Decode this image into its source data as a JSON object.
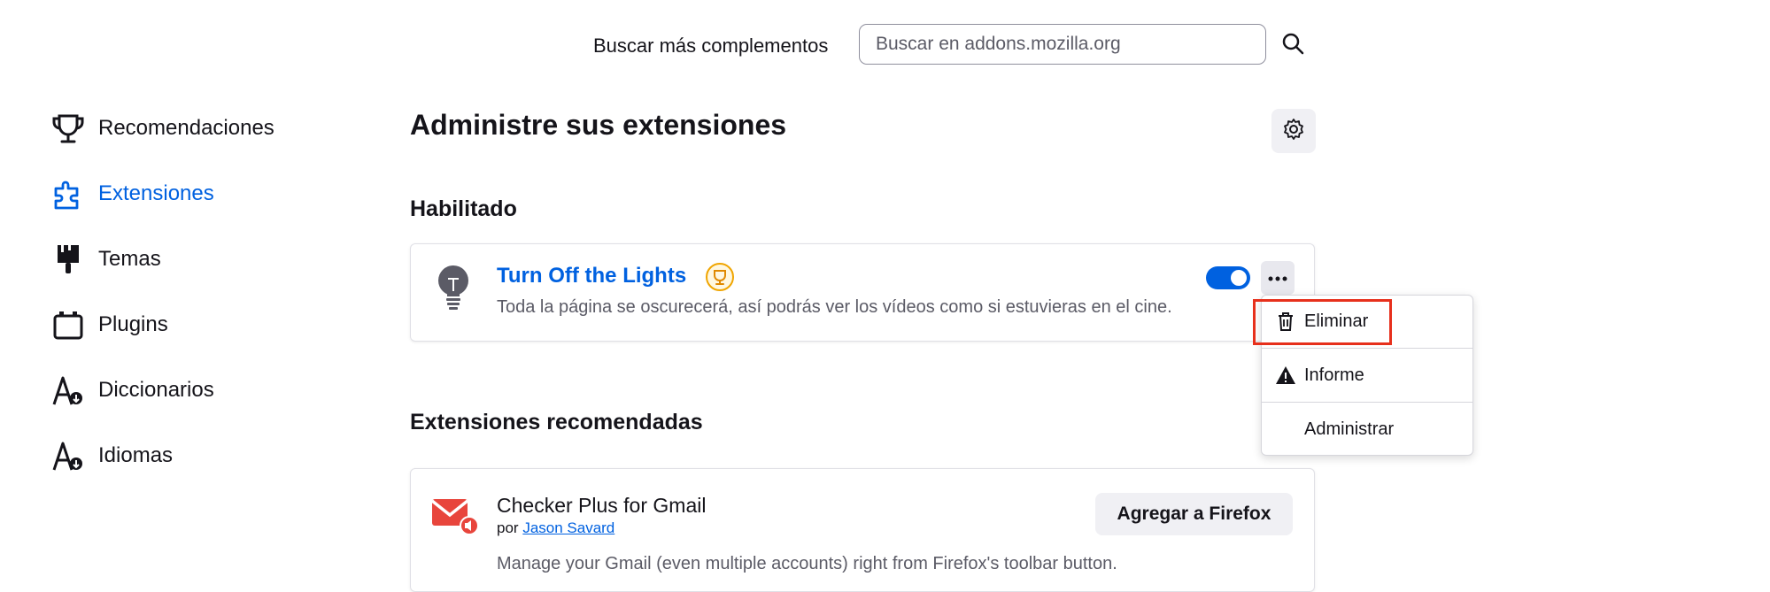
{
  "search": {
    "label": "Buscar más complementos",
    "placeholder": "Buscar en addons.mozilla.org",
    "button_icon": "search-icon"
  },
  "sidebar": {
    "items": [
      {
        "label": "Recomendaciones",
        "icon": "trophy-icon"
      },
      {
        "label": "Extensiones",
        "icon": "puzzle-icon",
        "active": true
      },
      {
        "label": "Temas",
        "icon": "paintbrush-icon"
      },
      {
        "label": "Plugins",
        "icon": "plugin-icon"
      },
      {
        "label": "Diccionarios",
        "icon": "dictionary-icon"
      },
      {
        "label": "Idiomas",
        "icon": "language-icon"
      }
    ]
  },
  "main": {
    "title": "Administre sus extensiones",
    "settings_icon": "gear-icon",
    "enabled_heading": "Habilitado",
    "extension": {
      "name": "Turn Off the Lights",
      "description": "Toda la página se oscurecerá, así podrás ver los vídeos como si estuvieras en el cine.",
      "enabled": true,
      "badge_icon": "recommended-trophy-icon"
    },
    "menu": {
      "items": [
        {
          "label": "Eliminar",
          "icon": "trash-icon",
          "highlighted": true
        },
        {
          "label": "Informe",
          "icon": "warning-icon"
        },
        {
          "label": "Administrar",
          "icon": ""
        }
      ]
    },
    "recommended_heading": "Extensiones recomendadas",
    "recommended": {
      "name": "Checker Plus for Gmail",
      "by_prefix": "por",
      "author": "Jason Savard",
      "add_button": "Agregar a Firefox",
      "description": "Manage your Gmail (even multiple accounts) right from Firefox's toolbar button."
    }
  },
  "colors": {
    "accent": "#0061e0",
    "highlight_border": "#e7301c",
    "text": "#15141a",
    "muted_text": "#5b5b66"
  }
}
